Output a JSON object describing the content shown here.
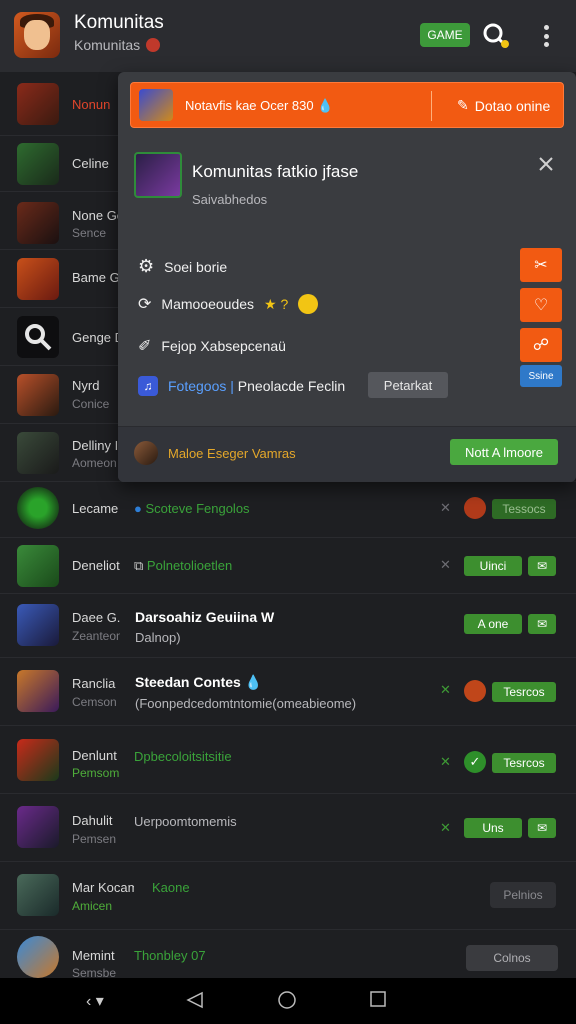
{
  "header": {
    "title": "Komunitas",
    "subtitle": "Komunitas",
    "game_button": "GAME",
    "icons": [
      "app-avatar",
      "search-icon",
      "more-vert-icon"
    ]
  },
  "list": [
    {
      "name": "Nonun",
      "sub": "",
      "name_color": "red"
    },
    {
      "name": "Celine",
      "sub": ""
    },
    {
      "name": "None Ge",
      "sub": "Sence"
    },
    {
      "name": "Bame G",
      "sub": ""
    },
    {
      "name": "Genge D",
      "sub": ""
    },
    {
      "name": "Nyrd",
      "sub": "Conice"
    },
    {
      "name": "Delliny II",
      "sub": "Aomeon"
    },
    {
      "name": "Lecame",
      "sub": ""
    },
    {
      "name": "Deneliot",
      "sub": ""
    },
    {
      "name": "Daee G.",
      "sub": "Zeanteon"
    },
    {
      "name": "Ranclia",
      "sub": "Cemson"
    },
    {
      "name": "Denlunt",
      "sub": "Pemsom",
      "sub_color": "green"
    },
    {
      "name": "Dahulit",
      "sub": "Pemsen"
    },
    {
      "name": "Mar Kocame",
      "sub": "Amicen",
      "sub_color": "green"
    },
    {
      "name": "Memint",
      "sub": "Semsbe"
    }
  ],
  "rows_content": {
    "r8": {
      "text": "Scoteve Fengolos",
      "button": "Tessocs"
    },
    "r9": {
      "text": "Polnetolioetlen",
      "button": "Uinci"
    },
    "r10": {
      "title": "Darsoahiz Geuiina W",
      "sub": "Dalnop)",
      "button": "A one"
    },
    "r11": {
      "title": "Steedan Contes",
      "sub": "(Foonpedcedomtntomie(omeabieome)",
      "button": "Tesrcos"
    },
    "r12": {
      "text": "Dpbecoloitsitsitie",
      "button": "Tesrcos"
    },
    "r13": {
      "text": "Uerpoomtomemis",
      "button": "Uns"
    },
    "r14": {
      "text": "Kaone",
      "button": "Pelnios"
    },
    "r15": {
      "text": "Thonbley 07",
      "button": "Colnos"
    }
  },
  "card": {
    "banner_text": "Notavfis kae Ocer 830",
    "banner_button": "Dotao onine",
    "game_title": "Komunitas fatkio jfase",
    "game_sub": "Saivabhedos",
    "menu": [
      {
        "label": "Soei borie",
        "icon": "gear-icon"
      },
      {
        "label": "Mamooeoudes",
        "icon": "emoji-icon",
        "suffix": "★ ?"
      },
      {
        "label": "Fejop Xabsepcenaü",
        "icon": "pin-icon"
      },
      {
        "label": "Fotegoos | Pneolacde Feclin",
        "icon": "music-icon",
        "link": "Fotegoos |",
        "rest": " Pneolacde Feclin"
      }
    ],
    "pill": "Petarkat",
    "side_small": "Ssine",
    "footer_text": "Maloe Eseger Vamras",
    "footer_button": "Nott A lmoore"
  }
}
